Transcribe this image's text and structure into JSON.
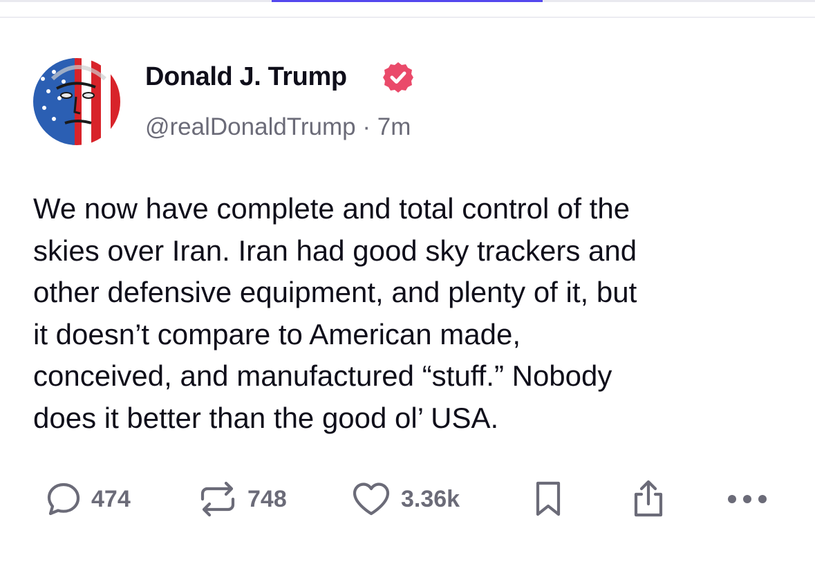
{
  "post": {
    "author": {
      "display_name": "Donald J. Trump",
      "handle": "@realDonaldTrump",
      "separator": "·",
      "time_ago": "7m",
      "verified": true,
      "avatar_icon": "flag-face-avatar"
    },
    "text": "We now have complete and total control of the\nskies over Iran. Iran had good sky trackers and\nother defensive equipment, and plenty of it, but\nit doesn’t compare to American made,\nconceived, and manufactured “stuff.”  Nobody\ndoes it better than the good ol’ USA."
  },
  "actions": {
    "replies": "474",
    "retruths": "748",
    "likes": "3.36k"
  },
  "icons": {
    "reply": "speech-bubble-icon",
    "retruth": "repost-arrows-icon",
    "like": "heart-icon",
    "bookmark": "bookmark-icon",
    "share": "share-icon",
    "more": "ellipsis-icon",
    "verified": "verified-badge-icon"
  },
  "colors": {
    "accent_tab": "#5448ee",
    "verified_badge": "#ea4a6a",
    "muted_text": "#6b6b78",
    "text": "#0f0e1a"
  }
}
